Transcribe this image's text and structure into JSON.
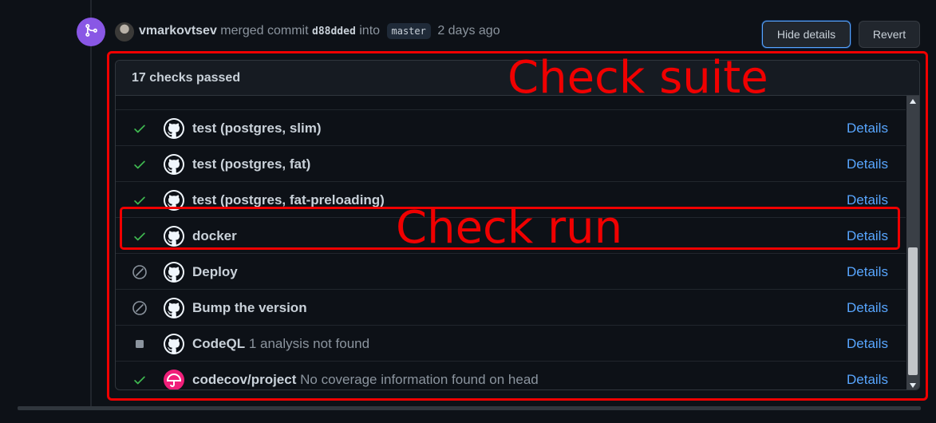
{
  "event": {
    "actor": "vmarkovtsev",
    "action": "merged commit",
    "sha": "d88dded",
    "into": "into",
    "branch": "master",
    "time": "2 days ago"
  },
  "buttons": {
    "hide_details": "Hide details",
    "revert": "Revert"
  },
  "checks": {
    "summary": "17 checks passed",
    "rows": [
      {
        "status": "success",
        "app": "github",
        "name": "test (postgres, slim)",
        "description": "",
        "details": "Details"
      },
      {
        "status": "success",
        "app": "github",
        "name": "test (postgres, fat)",
        "description": "",
        "details": "Details"
      },
      {
        "status": "success",
        "app": "github",
        "name": "test (postgres, fat-preloading)",
        "description": "",
        "details": "Details"
      },
      {
        "status": "success",
        "app": "github",
        "name": "docker",
        "description": "",
        "details": "Details"
      },
      {
        "status": "skipped",
        "app": "github",
        "name": "Deploy",
        "description": "",
        "details": "Details"
      },
      {
        "status": "skipped",
        "app": "github",
        "name": "Bump the version",
        "description": "",
        "details": "Details"
      },
      {
        "status": "neutral",
        "app": "github",
        "name": "CodeQL",
        "description": "1 analysis not found",
        "details": "Details"
      },
      {
        "status": "success",
        "app": "codecov",
        "name": "codecov/project",
        "description": "No coverage information found on head",
        "details": "Details"
      }
    ]
  },
  "annotations": {
    "suite_label": "Check suite",
    "run_label": "Check run"
  },
  "colors": {
    "success": "#3fb950",
    "muted": "#8b949e",
    "link": "#58a6ff",
    "merge_badge": "#8957e5",
    "annotation": "#f00000",
    "codecov": "#f01f7a"
  },
  "icons": {
    "merge": "git-merge-icon",
    "success": "check-icon",
    "skipped": "skip-icon",
    "neutral": "square-icon",
    "github": "github-mark-icon",
    "codecov": "codecov-umbrella-icon"
  }
}
